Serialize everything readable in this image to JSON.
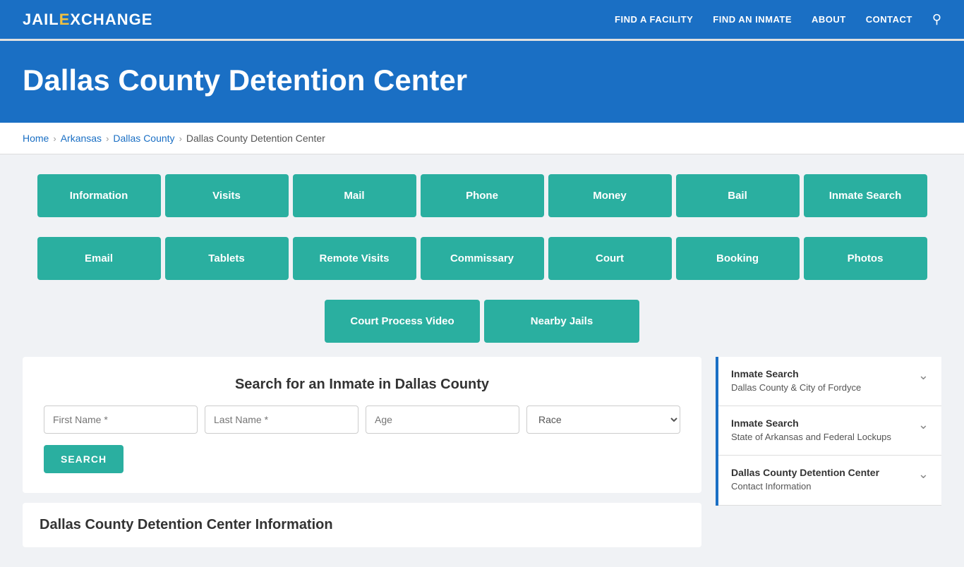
{
  "nav": {
    "logo_jail": "JAIL",
    "logo_ex": "E",
    "logo_xchange": "XCHANGE",
    "links": [
      "FIND A FACILITY",
      "FIND AN INMATE",
      "ABOUT",
      "CONTACT"
    ]
  },
  "hero": {
    "title": "Dallas County Detention Center"
  },
  "breadcrumb": {
    "items": [
      "Home",
      "Arkansas",
      "Dallas County",
      "Dallas County Detention Center"
    ]
  },
  "grid": {
    "row1": [
      "Information",
      "Visits",
      "Mail",
      "Phone",
      "Money",
      "Bail",
      "Inmate Search"
    ],
    "row2": [
      "Email",
      "Tablets",
      "Remote Visits",
      "Commissary",
      "Court",
      "Booking",
      "Photos"
    ],
    "row3": [
      "Court Process Video",
      "Nearby Jails"
    ]
  },
  "search": {
    "title": "Search for an Inmate in Dallas County",
    "first_name_placeholder": "First Name *",
    "last_name_placeholder": "Last Name *",
    "age_placeholder": "Age",
    "race_placeholder": "Race",
    "button_label": "SEARCH"
  },
  "info": {
    "title": "Dallas County Detention Center Information"
  },
  "sidebar": {
    "items": [
      {
        "title": "Inmate Search",
        "sub": "Dallas County & City of Fordyce"
      },
      {
        "title": "Inmate Search",
        "sub": "State of Arkansas and Federal Lockups"
      },
      {
        "title": "Dallas County Detention Center",
        "sub": "Contact Information"
      }
    ]
  }
}
